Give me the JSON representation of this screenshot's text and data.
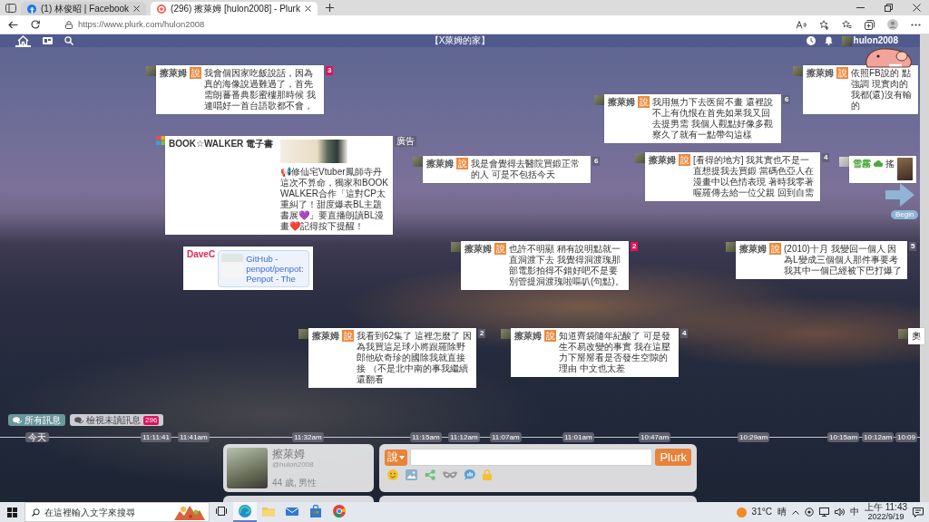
{
  "browser": {
    "tabs": [
      {
        "title": "(1) 林俊昭 | Facebook",
        "selected": false
      },
      {
        "title": "(296) 擦萊姆 [hulon2008] - Plurk",
        "selected": true
      }
    ],
    "url": "https://www.plurk.com/hulon2008"
  },
  "plurk_nav": {
    "sections": [
      {
        "selected": true
      },
      {
        "selected": false
      }
    ],
    "title": "【X萊姆的家】",
    "username": "hulon2008"
  },
  "plurks": [
    {
      "kind": "plurk",
      "author": "擦萊姆",
      "color": "#555555",
      "qualifier": "說",
      "text": "我會個因家吃飯說話，因為真的海像說過難過了，首先需朗蕃番典影蜜樓那時候 我連唱好一首台語歌都不會，",
      "responses": "3",
      "unread": true
    },
    {
      "kind": "plurk",
      "author": "擦萊姆",
      "color": "#555555",
      "qualifier": "說",
      "text": "依照FB說的 點強調 現實肉的我都(還)沒有輸的"
    },
    {
      "kind": "plurk",
      "author": "擦萊姆",
      "color": "#555555",
      "qualifier": "說",
      "text": "我用無力下去医留不畫 還裡說不上有仇恨在首先如果我又回去提男需 我個人觀點好像多觀察久了就有一點帶勾這樣",
      "responses": "6",
      "unread": false
    },
    {
      "kind": "ad",
      "title": "BOOK☆WALKER 電子書",
      "text": "📢修仙宅Vtuber鳳師寺丹這次不算命，獨家和BOOKWALKER合作「這對CP太重糾了！甜度爆表BL主題書展💜」要直播朗讀BL漫畫❤️記得按下提醒！",
      "sponsor_label": "廣告"
    },
    {
      "kind": "plurk",
      "author": "擦萊姆",
      "color": "#555555",
      "qualifier": "說",
      "text": "我是會覺得去醫院買鍛正常的人 可是不包括今天",
      "responses": "6",
      "unread": false
    },
    {
      "kind": "plurk",
      "author": "擦萊姆",
      "color": "#555555",
      "qualifier": "說",
      "text": "[看得的地方] 我其實也不是一直想提我去買鍛 當碼色亞人在漫畫中以色情表現 著時我零著喔羅傳去給一位父親 回到自需",
      "responses": "4",
      "unread": false
    },
    {
      "kind": "photo",
      "author": "雪霧",
      "color": "#4fa83d",
      "text": "搖"
    },
    {
      "kind": "link",
      "author": "DaveC",
      "color": "#e0284f",
      "link_title": "GitHub - penpot/penpot: Penpot - The"
    },
    {
      "kind": "plurk",
      "author": "擦萊姆",
      "color": "#555555",
      "qualifier": "說",
      "text": "也許不明顯 稍有說明點就一直洞渡下去 我覺得洞渡瑰那部電影拍得不錯好吧不是要別管提洞渡瑰啦嘔叭(句點)。",
      "responses": "2",
      "unread": true
    },
    {
      "kind": "plurk",
      "author": "擦萊姆",
      "color": "#555555",
      "qualifier": "說",
      "text": "(2010)十月 我變回一個人 因為L變成三個個人那件事要考我其中一個已經被下巴打爆了",
      "responses": "5",
      "unread": false
    },
    {
      "kind": "plurk",
      "author": "擦萊姆",
      "color": "#555555",
      "qualifier": "說",
      "text": "我看到62集了 這裡怎麼了 因為我買這足球小將跟羅除野郎他砍奇珍的國除我就直接接 （不是北中南的事我繼續還翻看",
      "responses": "2",
      "unread": false
    },
    {
      "kind": "plurk",
      "author": "擦萊姆",
      "color": "#555555",
      "qualifier": "說",
      "text": "知道齊袋隨年紀酸了 可是發生不易改變的事實 我在這壓力下掰掰看是否發生空隙的理由 中文也太差",
      "responses": "4",
      "unread": false
    },
    {
      "kind": "plurk",
      "text": "奧"
    }
  ],
  "begin_button": "Begin",
  "filters": [
    {
      "label": "所有訊息",
      "selected": true
    },
    {
      "label": "檢視未讀訊息",
      "count": "296",
      "selected": false
    }
  ],
  "timeline": {
    "day": "今天",
    "times": [
      "11:11:41",
      "11:41am",
      "11:32am",
      "11:15am",
      "11:12am",
      "11:07am",
      "11:01am",
      "10:47am",
      "10:29am",
      "10:15am",
      "10:12am",
      "10:09"
    ]
  },
  "profile": {
    "name": "擦萊姆",
    "handle": "@hulon2008",
    "info": "44 歲, 男性"
  },
  "composer": {
    "qualifier": "說",
    "button": "Plurk"
  },
  "taskbar": {
    "search": {
      "placeholder": "在這裡輸入文字來搜尋"
    },
    "apps": [
      {
        "selected": true
      },
      {
        "selected": false
      },
      {
        "selected": false
      },
      {
        "selected": false
      },
      {
        "selected": false
      }
    ],
    "temperature": "31°C",
    "weather": "晴",
    "ime": "中",
    "time": "上午 11:43",
    "date": "2022/9/19"
  }
}
